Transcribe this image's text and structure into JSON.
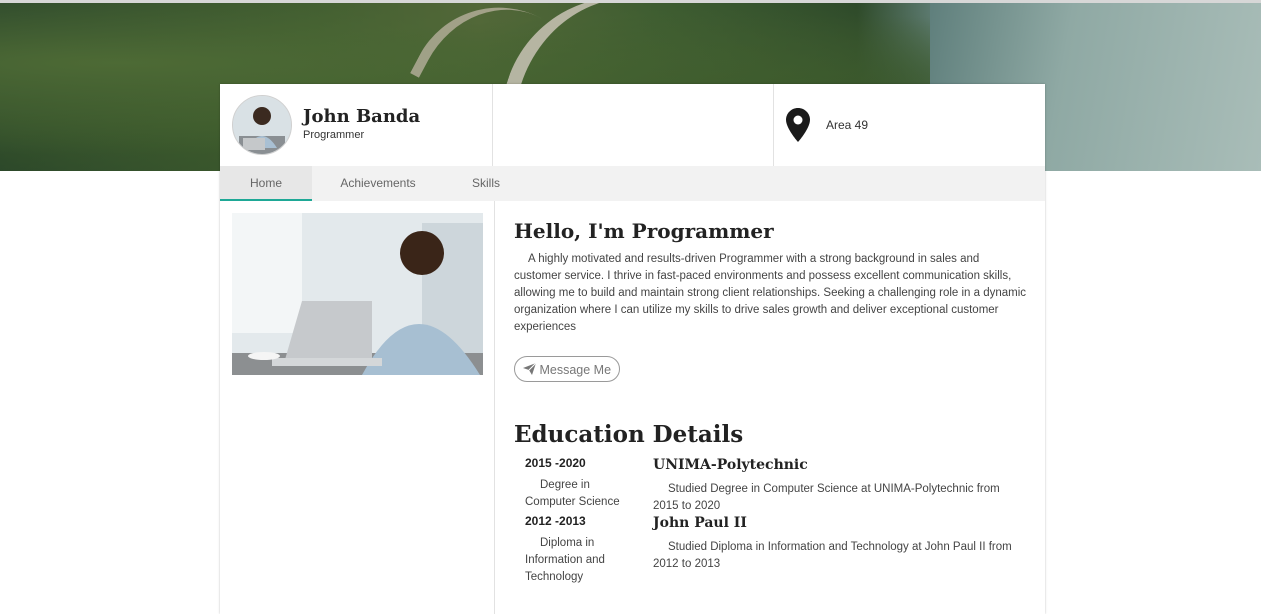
{
  "profile": {
    "name": "John Banda",
    "role": "Programmer",
    "location": "Area 49"
  },
  "tabs": [
    {
      "label": "Home"
    },
    {
      "label": "Achievements"
    },
    {
      "label": "Skills"
    }
  ],
  "about": {
    "heading": "Hello, I'm Programmer",
    "bio": "A highly motivated and results-driven Programmer with a strong background in sales and customer service. I thrive in fast-paced environments and possess excellent communication skills, allowing me to build and maintain strong client relationships. Seeking a challenging role in a dynamic organization where I can utilize my skills to drive sales growth and deliver exceptional customer experiences",
    "message_button": "Message Me"
  },
  "education": {
    "heading": "Education Details",
    "items": [
      {
        "years": "2015 -2020",
        "degree": "Degree in Computer Science",
        "institution": "UNIMA-Polytechnic",
        "description": "Studied Degree in Computer Science at UNIMA-Polytechnic from 2015 to 2020"
      },
      {
        "years": "2012 -2013",
        "degree": "Diploma in Information and Technology",
        "institution": "John Paul II",
        "description": "Studied Diploma in Information and Technology at John Paul II from 2012 to 2013"
      }
    ]
  },
  "icons": {
    "location": "map-pin-icon",
    "send": "paper-plane-icon"
  },
  "colors": {
    "accent": "#1ea896"
  }
}
